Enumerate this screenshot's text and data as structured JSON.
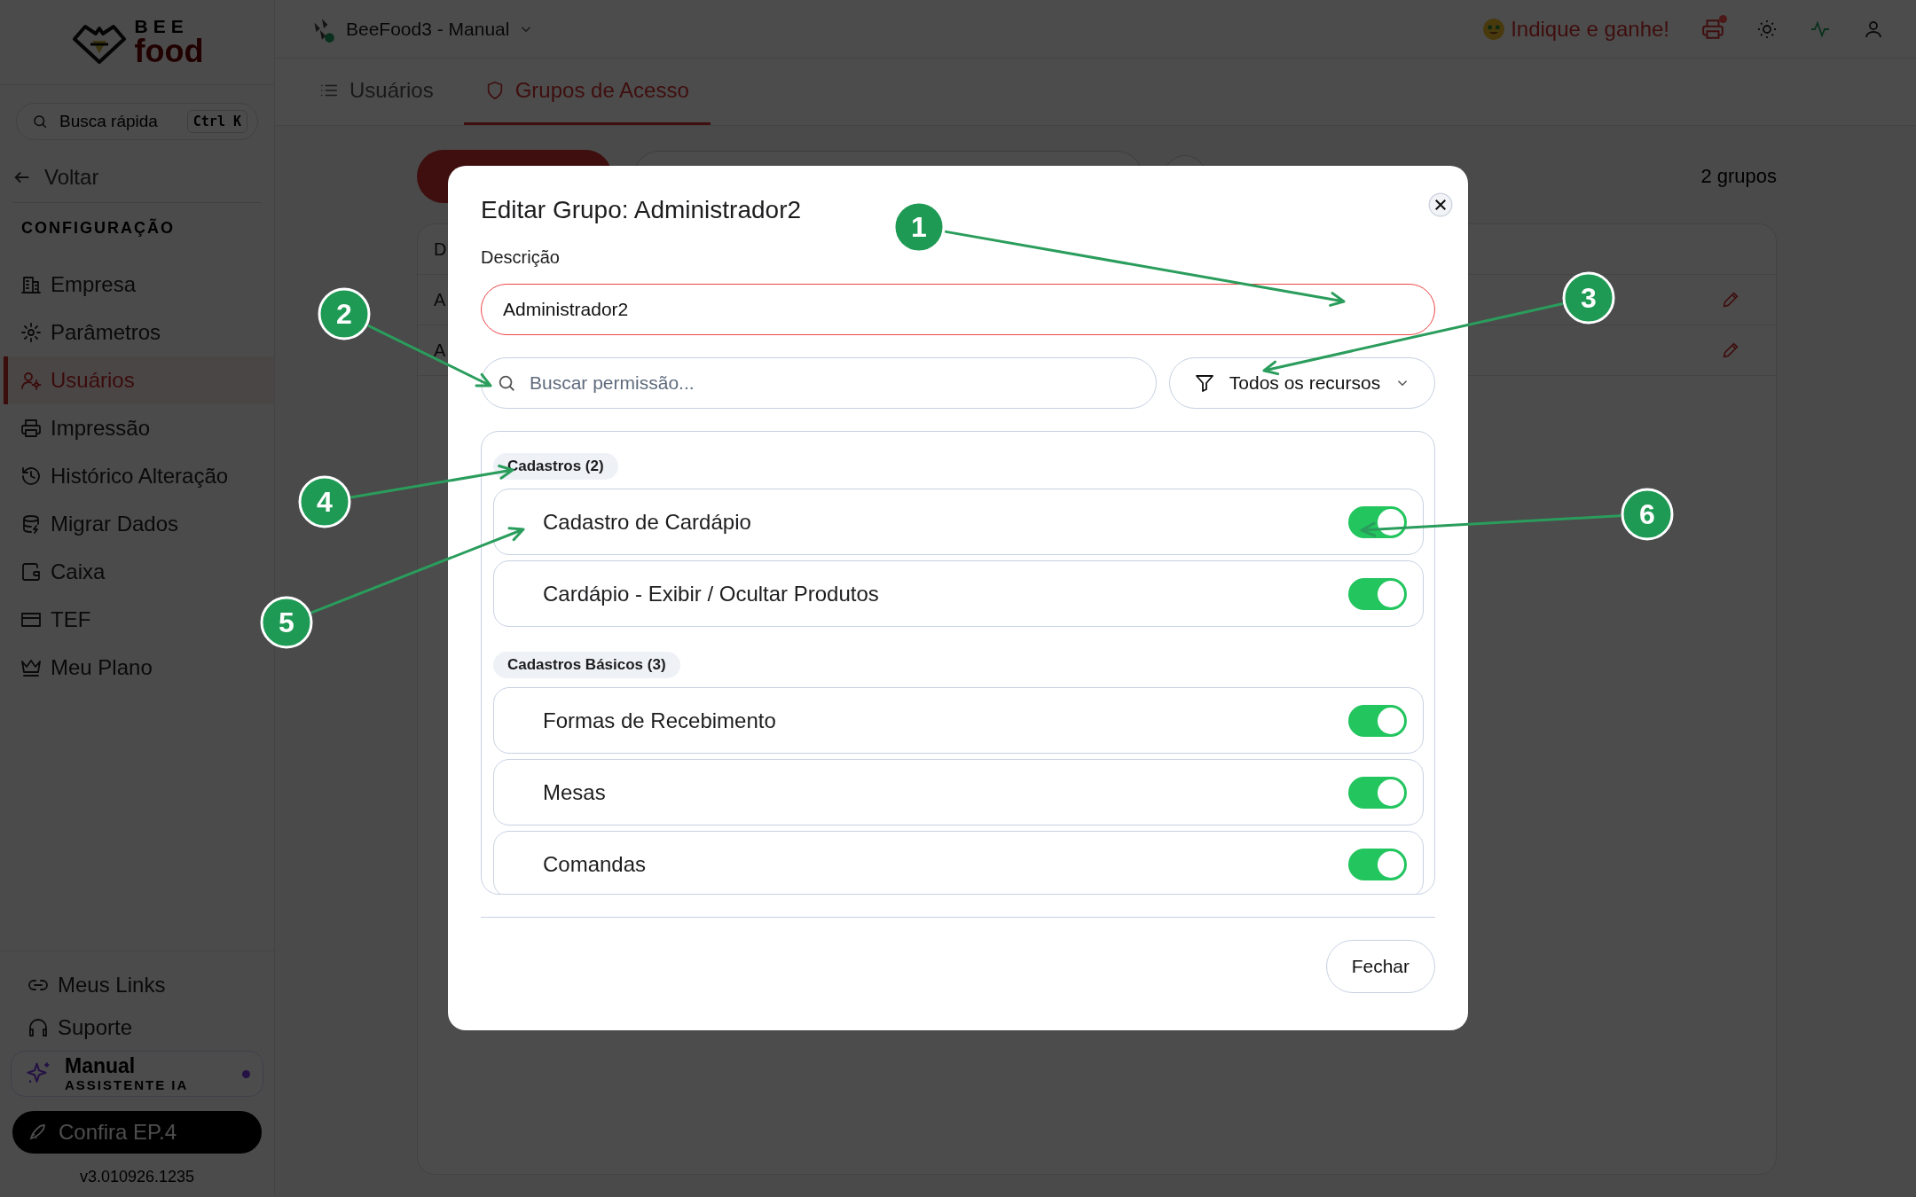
{
  "sidebar": {
    "logo": {
      "line1": "BEE",
      "line2": "food"
    },
    "search": {
      "placeholder": "Busca rápida",
      "shortcut": "Ctrl K"
    },
    "back": "Voltar",
    "section": "CONFIGURAÇÃO",
    "items": [
      {
        "label": "Empresa",
        "selected": false
      },
      {
        "label": "Parâmetros",
        "selected": false
      },
      {
        "label": "Usuários",
        "selected": true
      },
      {
        "label": "Impressão",
        "selected": false
      },
      {
        "label": "Histórico Alteração",
        "selected": false
      },
      {
        "label": "Migrar Dados",
        "selected": false
      },
      {
        "label": "Caixa",
        "selected": false
      },
      {
        "label": "TEF",
        "selected": false
      },
      {
        "label": "Meu Plano",
        "selected": false
      }
    ],
    "footer_items": [
      {
        "label": "Meus Links"
      },
      {
        "label": "Suporte"
      }
    ],
    "assistant": {
      "title": "Manual",
      "subtitle": "ASSISTENTE IA"
    },
    "promo": "Confira EP.4",
    "version": "v3.010926.1235"
  },
  "topbar": {
    "app": "BeeFood3 - Manual",
    "referral": "Indique e ganhe!"
  },
  "tabs": [
    {
      "label": "Usuários",
      "selected": false
    },
    {
      "label": "Grupos de Acesso",
      "selected": true
    }
  ],
  "content": {
    "count": "2 grupos",
    "table": {
      "columns": [
        "D"
      ],
      "rows": [
        {
          "cells": [
            "A"
          ]
        },
        {
          "cells": [
            "A"
          ]
        }
      ]
    }
  },
  "modal": {
    "title": "Editar Grupo: Administrador2",
    "field_label": "Descrição",
    "value": "Administrador2",
    "search": {
      "placeholder": "Buscar permissão..."
    },
    "filter": "Todos os recursos",
    "groups": [
      {
        "label": "Cadastros (2)",
        "items": [
          {
            "label": "Cadastro de Cardápio",
            "on": true
          },
          {
            "label": "Cardápio - Exibir / Ocultar Produtos",
            "on": true
          }
        ]
      },
      {
        "label": "Cadastros Básicos (3)",
        "items": [
          {
            "label": "Formas de Recebimento",
            "on": true
          },
          {
            "label": "Mesas",
            "on": true
          },
          {
            "label": "Comandas",
            "on": true
          }
        ]
      }
    ],
    "close_button": "Fechar"
  },
  "callouts": [
    {
      "label": "1"
    },
    {
      "label": "2"
    },
    {
      "label": "3"
    },
    {
      "label": "4"
    },
    {
      "label": "5"
    },
    {
      "label": "6"
    }
  ]
}
